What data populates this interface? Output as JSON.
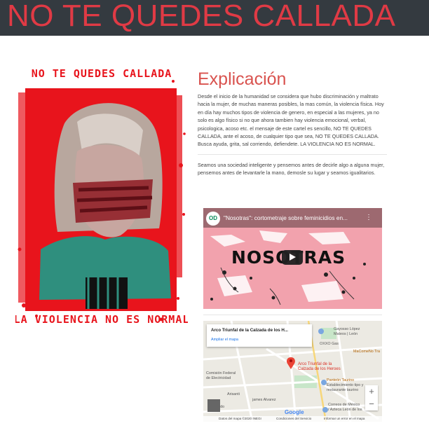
{
  "header": {
    "title": "NO TE QUEDES CALLADA"
  },
  "poster": {
    "top_text": "NO TE QUEDES CALLADA",
    "bottom_text": "LA VIOLENCIA NO ES NORMAL",
    "colors": {
      "red": "#e8141c",
      "teal": "#2f8f7e"
    }
  },
  "explanation": {
    "title": "Explicación",
    "paragraph1": "Desde el inicio de la humanidad se considera que hubo discriminación y maltrato hacia la mujer, de muchas maneras posibles, la mas común, la violencia física. Hoy en día hay muchos tipos de violencia de genero, en especial a las mujeres, ya no solo es algo físico si no que ahora tambien hay violencia emocional, verbal, psicologica, acoso etc. el mensaje de este cartel es sencillo, NO TE QUEDES CALLADA, ante el acoso, de cualquier tipo que sea, NO TE QUEDES CALLADA. Busca ayuda, grita, sal corriendo, defiendete. LA VIOLENCIA NO ES NORMAL.",
    "paragraph2": "Seamos una sociedad inteligente y pensemos antes de decirle algo a alguna mujer, pensemos antes de levantarle la mano, demosle su lugar y seamos igualitarios."
  },
  "video": {
    "channel_badge": "OD",
    "title": "\"Nosotras\": cortometraje sobre feminicidios en...",
    "overlay_text": "NOSOTRAS",
    "more_icon": "more-vert-icon",
    "play_icon": "play-icon"
  },
  "map": {
    "place_title": "Arco Triunfal de la Calzada de los H...",
    "enlarge_link": "Ampliar el mapa",
    "pin_label": "Arco Triunfal de la\nCalzada de los Heroes",
    "labels": {
      "gayosso": "Gayosso López\nMateos | León",
      "oxxo": "OXXO Gas",
      "macomeno": "MaComeNo Tra",
      "panteon": "Panteón Taurino",
      "panteon_sub": "Establecimiento tipo y\nrestaurante taurino",
      "comision": "Comisión Federal\nde Electricidad",
      "correos": "Correos de México\n/ Azteca León de los",
      "guajardo": "Guajardo",
      "james": "james Alvarez",
      "arisanti": "Arisanti"
    },
    "zoom_in": "+",
    "zoom_out": "−",
    "google": "Google",
    "footer": {
      "data": "Datos del mapa ©2020 INEGI",
      "terms": "Condiciones del Servicio",
      "report": "Informar un error en el mapa"
    },
    "colors": {
      "pin": "#ea4335",
      "park": "#c8e6c9",
      "road": "#ffffff"
    }
  }
}
